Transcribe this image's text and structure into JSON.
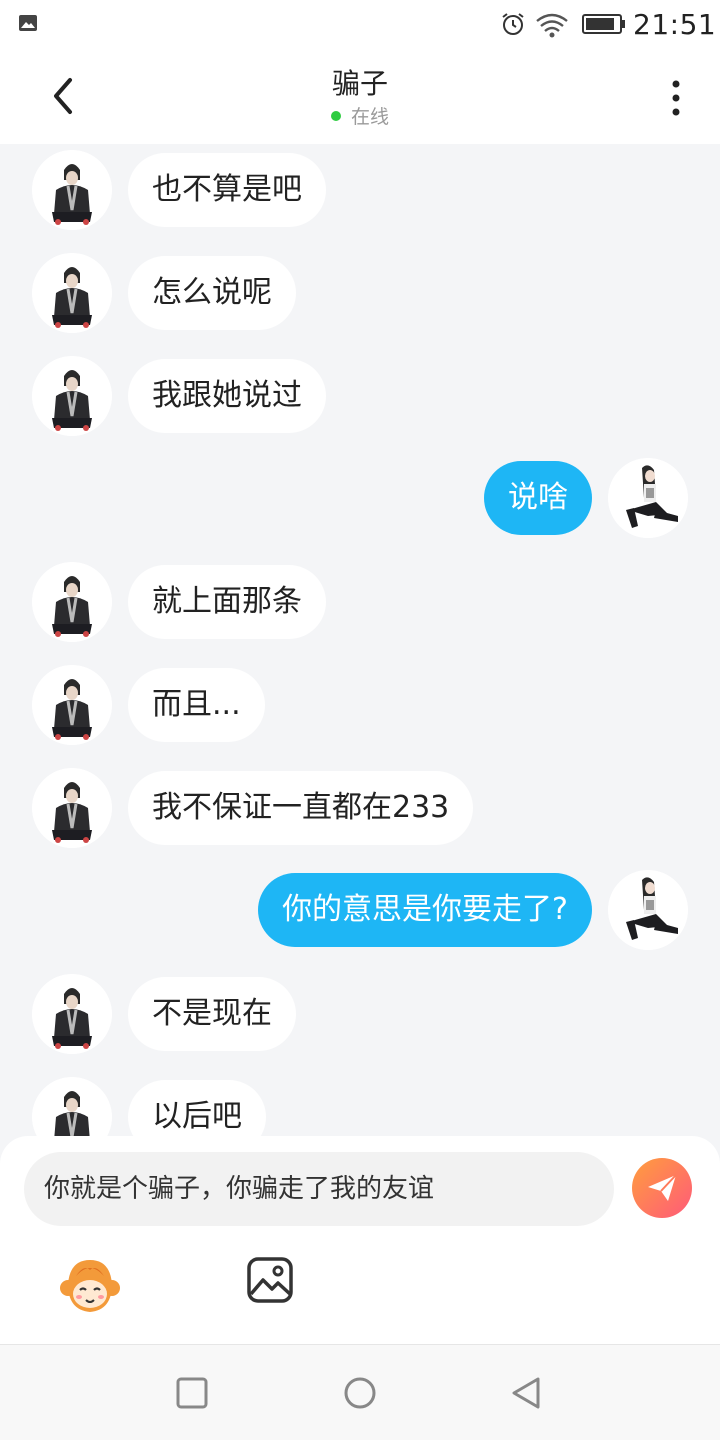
{
  "status_bar": {
    "time": "21:51",
    "icons": [
      "gallery-icon",
      "alarm-icon",
      "wifi-icon",
      "battery-icon"
    ]
  },
  "header": {
    "title": "骗子",
    "status": "在线",
    "status_color": "#2ecc40"
  },
  "messages": [
    {
      "side": "left",
      "text": "也不算是吧"
    },
    {
      "side": "left",
      "text": "怎么说呢"
    },
    {
      "side": "left",
      "text": "我跟她说过"
    },
    {
      "side": "right",
      "text": "说啥"
    },
    {
      "side": "left",
      "text": "就上面那条"
    },
    {
      "side": "left",
      "text": "而且..."
    },
    {
      "side": "left",
      "text": "我不保证一直都在233"
    },
    {
      "side": "right",
      "text": "你的意思是你要走了?"
    },
    {
      "side": "left",
      "text": "不是现在"
    },
    {
      "side": "left",
      "text": "以后吧"
    }
  ],
  "composer": {
    "input_value": "你就是个骗子，你骗走了我的友谊",
    "send_icon": "paper-plane-icon",
    "emoji_icon": "monkey-emoji-icon",
    "image_icon": "image-icon"
  },
  "colors": {
    "outgoing_bubble": "#1eb6f5",
    "incoming_bubble": "#ffffff",
    "background": "#f4f5f7",
    "send_gradient": [
      "#ff9e3d",
      "#ff5a7a"
    ]
  },
  "nav_bar": {
    "buttons": [
      "recent-apps-icon",
      "home-icon",
      "back-nav-icon"
    ]
  }
}
